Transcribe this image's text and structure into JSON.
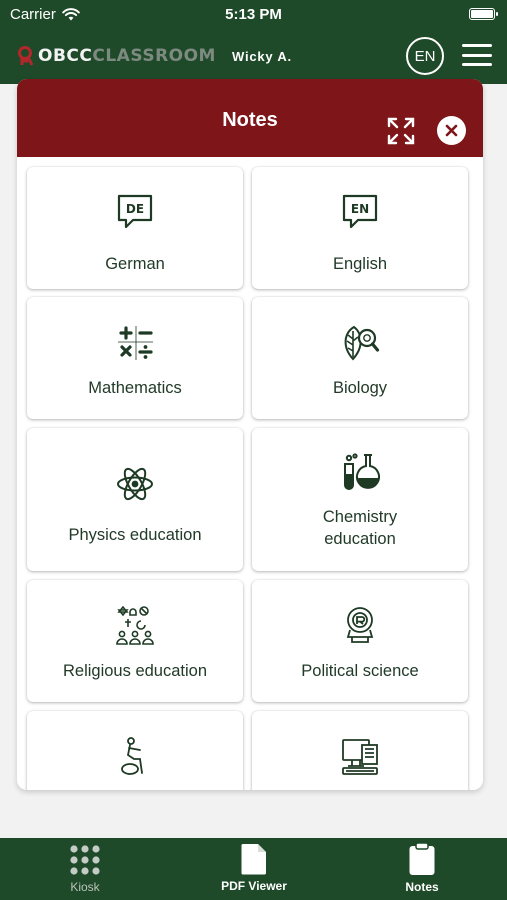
{
  "status_bar": {
    "carrier": "Carrier",
    "time": "5:13 PM",
    "wifi_icon": "wifi-icon",
    "battery_icon": "battery-icon"
  },
  "header": {
    "logo_part1": "OBCC",
    "logo_part2": "CLASSROOM",
    "user_name": "Wicky  A.",
    "language": "EN",
    "menu_icon": "hamburger-icon"
  },
  "modal": {
    "title": "Notes",
    "expand_icon": "expand-icon",
    "close_icon": "close-icon",
    "subjects": [
      {
        "label": "German",
        "icon": "speech-bubble-de-icon",
        "icon_text": "DE"
      },
      {
        "label": "English",
        "icon": "speech-bubble-en-icon",
        "icon_text": "EN"
      },
      {
        "label": "Mathematics",
        "icon": "math-operators-icon"
      },
      {
        "label": "Biology",
        "icon": "leaf-magnifier-icon"
      },
      {
        "label": "Physics education",
        "icon": "atom-icon"
      },
      {
        "label": "Chemistry education",
        "icon": "flask-icon"
      },
      {
        "label": "Religious education",
        "icon": "religions-icon"
      },
      {
        "label": "Political science",
        "icon": "podium-icon"
      },
      {
        "label": "",
        "icon": "person-sitting-icon"
      },
      {
        "label": "",
        "icon": "computer-icon"
      }
    ]
  },
  "tabbar": {
    "tabs": [
      {
        "label": "Kiosk",
        "icon": "grid-dots-icon"
      },
      {
        "label": "PDF Viewer",
        "icon": "document-icon"
      },
      {
        "label": "Notes",
        "icon": "clipboard-icon"
      }
    ]
  },
  "colors": {
    "header_green": "#1f4a2a",
    "modal_red": "#7e1519",
    "icon_green": "#1e3a24"
  }
}
